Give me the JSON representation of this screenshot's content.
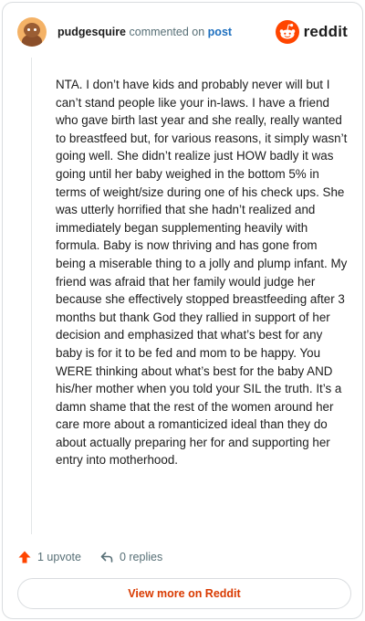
{
  "header": {
    "username": "pudgesquire",
    "action_text": "commented on",
    "post_link": "post",
    "brand": "reddit",
    "avatar_icon": "snoo-avatar-icon",
    "logo_icon": "reddit-logo-icon"
  },
  "comment": {
    "body": "NTA. I don’t have kids and probably never will but I can’t stand people like your in-laws. I have a friend who gave birth last year and she really, really wanted to breastfeed but, for various reasons, it simply wasn’t going well. She didn’t realize just HOW badly it was going until her baby weighed in the bottom 5% in terms of weight/size during one of his check ups. She was utterly horrified that she hadn’t realized and immediately began supplementing heavily with formula. Baby is now thriving and has gone from being a miserable thing to a jolly and plump infant. My friend was afraid that her family would judge her because she effectively stopped breastfeeding after 3 months but thank God they rallied in support of her decision and emphasized that what’s best for any baby is for it to be fed and mom to be happy. You WERE thinking about what’s best for the baby AND his/her mother when you told your SIL the truth. It’s a damn shame that the rest of the women around her care more about a romanticized ideal than they do about actually preparing her for and supporting her entry into motherhood."
  },
  "actions": {
    "upvote_label": "1 upvote",
    "replies_label": "0 replies",
    "upvote_icon": "upvote-arrow-icon",
    "reply_icon": "reply-arrow-icon"
  },
  "footer": {
    "view_more_label": "View more on Reddit"
  },
  "colors": {
    "accent": "#d93a00",
    "upvote": "#ff4500",
    "link": "#1d6fbf",
    "muted": "#576f76",
    "border": "#d9dcdf"
  }
}
